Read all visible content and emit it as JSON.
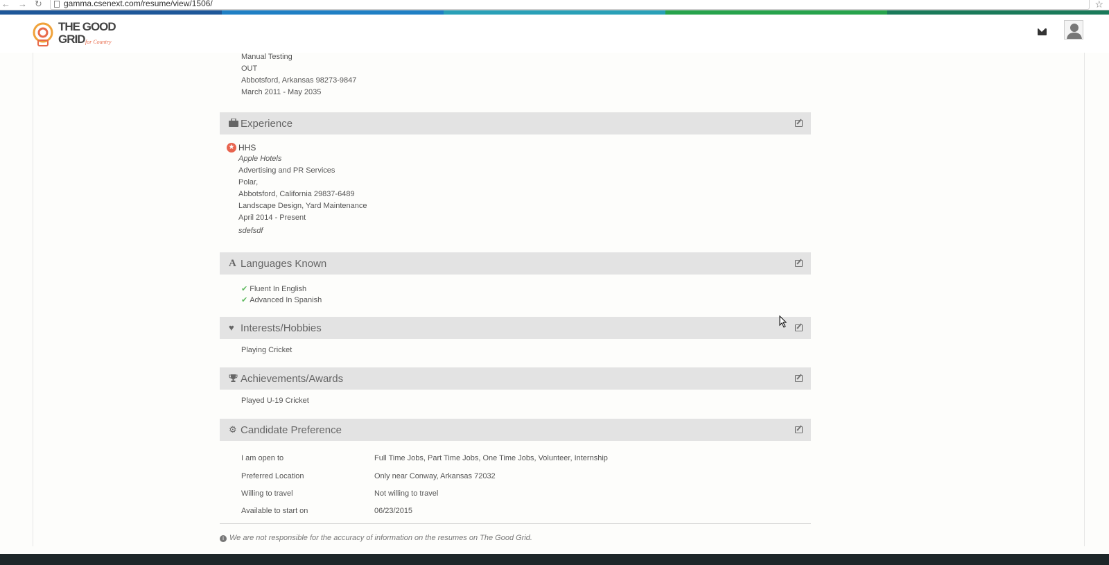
{
  "browser": {
    "url": "gamma.csenext.com/resume/view/1506/"
  },
  "colors": {
    "bar": [
      "#1e5799",
      "#1f7fc4",
      "#29a0b7",
      "#2aa38a",
      "#27a34c",
      "#1a7a5a"
    ]
  },
  "header": {
    "logo_text_top": "THE GOOD",
    "logo_text_bottom": "GRID",
    "logo_tagline": "for Country",
    "icons": [
      "envelope-icon",
      "user-icon"
    ]
  },
  "education_tail": {
    "lines": [
      "Manual Testing",
      "OUT",
      "Abbotsford, Arkansas  98273-9847",
      "March 2011 - May 2035"
    ]
  },
  "experience": {
    "title": "Experience",
    "icon": "briefcase-icon",
    "company": "HHS",
    "employer": "Apple Hotels",
    "industry": "Advertising and PR Services",
    "location_1": "Polar,",
    "location_2": "Abbotsford, California  29837-6489",
    "skills": "Landscape Design, Yard Maintenance",
    "dates": "April 2014 - Present",
    "description": "sdefsdf"
  },
  "languages": {
    "title": "Languages Known",
    "icon": "font-icon",
    "items": [
      "Fluent In English",
      "Advanced In Spanish"
    ]
  },
  "interests": {
    "title": "Interests/Hobbies",
    "icon": "heart-icon",
    "text": "Playing Cricket"
  },
  "achievements": {
    "title": "Achievements/Awards",
    "icon": "trophy-icon",
    "text": "Played U-19 Cricket"
  },
  "preference": {
    "title": "Candidate Preference",
    "icon": "gear-icon",
    "rows": [
      {
        "label": "I am open to",
        "value": "Full Time Jobs, Part Time Jobs, One Time Jobs, Volunteer, Internship"
      },
      {
        "label": "Preferred Location",
        "value": "Only near Conway, Arkansas 72032"
      },
      {
        "label": "Willing to travel",
        "value": "Not willing to travel"
      },
      {
        "label": "Available to start on",
        "value": "06/23/2015"
      }
    ]
  },
  "disclaimer": "We are not responsible for the accuracy of information on the resumes on The Good Grid."
}
